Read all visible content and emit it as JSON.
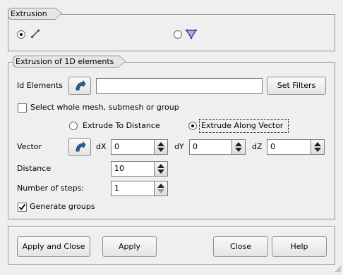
{
  "extrusion_group": {
    "title": "Extrusion",
    "options": [
      {
        "icon": "edge-icon",
        "checked": true
      },
      {
        "icon": "face-icon",
        "checked": false
      }
    ]
  },
  "elements_group": {
    "title": "Extrusion of 1D elements",
    "id_elements_label": "Id Elements",
    "id_elements_value": "",
    "set_filters_label": "Set Filters",
    "select_whole_label": "Select whole mesh, submesh or group",
    "select_whole_checked": false,
    "extrude_distance_label": "Extrude To Distance",
    "extrude_vector_label": "Extrude Along Vector",
    "extrude_mode": "vector",
    "vector_label": "Vector",
    "dx_label": "dX",
    "dx_value": "0",
    "dy_label": "dY",
    "dy_value": "0",
    "dz_label": "dZ",
    "dz_value": "0",
    "distance_label": "Distance",
    "distance_value": "10",
    "steps_label": "Number of steps:",
    "steps_value": "1",
    "generate_groups_label": "Generate groups",
    "generate_groups_checked": true
  },
  "buttons": {
    "apply_close": "Apply and Close",
    "apply": "Apply",
    "close": "Close",
    "help": "Help"
  },
  "colors": {
    "background": "#efefef",
    "frame_border": "#8d8d8d",
    "selection_icon_blue": "#2f5f9e",
    "face_icon_purple": "#6a4a9e"
  }
}
